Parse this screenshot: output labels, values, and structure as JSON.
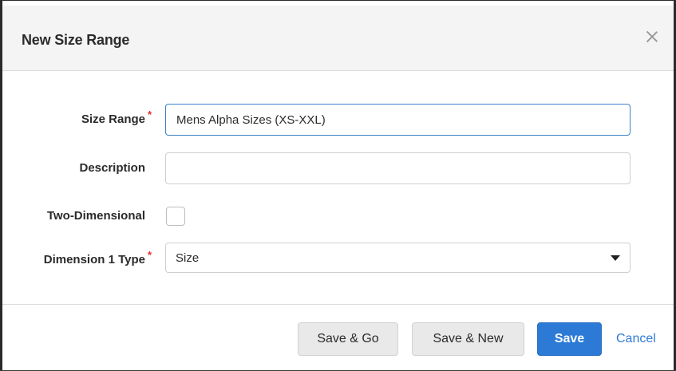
{
  "dialog": {
    "title": "New Size Range",
    "close_icon": "close-icon"
  },
  "form": {
    "size_range": {
      "label": "Size Range",
      "required": true,
      "required_marker": "*",
      "value": "Mens Alpha Sizes (XS-XXL)"
    },
    "description": {
      "label": "Description",
      "value": ""
    },
    "two_dimensional": {
      "label": "Two-Dimensional",
      "checked": false
    },
    "dimension_1_type": {
      "label": "Dimension 1 Type",
      "required": true,
      "required_marker": "*",
      "selected": "Size",
      "caret_icon": "caret-down-icon"
    }
  },
  "footer": {
    "save_go_label": "Save & Go",
    "save_new_label": "Save & New",
    "save_label": "Save",
    "cancel_label": "Cancel"
  },
  "colors": {
    "primary": "#2d7ad6",
    "required": "#e0302b",
    "focus_border": "#3b82c8"
  }
}
